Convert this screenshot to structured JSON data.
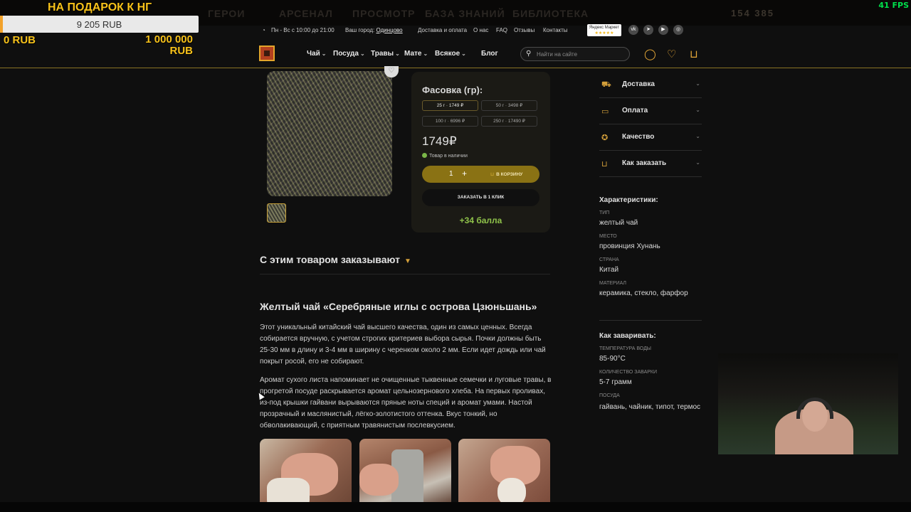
{
  "game": {
    "ghost_tabs": [
      "ГЕРОИ",
      "АРСЕНАЛ",
      "ПРОСМОТР",
      "БАЗА ЗНАНИЙ",
      "БИБЛИОТЕКА"
    ],
    "resources": "154 385",
    "fps": "41 FPS"
  },
  "donation": {
    "title": "НА ПОДАРОК К НГ",
    "amount": "9 205 RUB",
    "progress_fraction": 0.0092,
    "min": "0 RUB",
    "max_line1": "1 000 000",
    "max_line2": "RUB",
    "bar_fill_color": "#f2a22b",
    "text_color": "#f7c21a"
  },
  "topbar": {
    "hours": "Пн - Вс с 10:00 до 21:00",
    "city_label": "Ваш город:",
    "city": "Одинцово",
    "links": [
      "Доставка и оплата",
      "О нас",
      "FAQ",
      "Отзывы",
      "Контакты"
    ],
    "ya_market": "Яндекс Маркет",
    "ya_stars": "★★★★★",
    "social": [
      "vk-icon",
      "telegram-icon",
      "youtube-icon",
      "instagram-icon"
    ]
  },
  "nav": {
    "items": [
      "Чай",
      "Посуда",
      "Травы",
      "Мате",
      "Всякое"
    ],
    "blog": "Блог",
    "search_placeholder": "Найти на сайте",
    "accent": "#e6a838"
  },
  "product": {
    "pack_label": "Фасовка (гр):",
    "packs": [
      {
        "label": "25 г · 1749 ₽",
        "selected": true
      },
      {
        "label": "50 г · 3498 ₽",
        "selected": false
      },
      {
        "label": "100 г · 6996 ₽",
        "selected": false
      },
      {
        "label": "250 г · 17490 ₽",
        "selected": false
      }
    ],
    "price": "1749₽",
    "stock": "Товар в наличии",
    "qty": "1",
    "plus": "+",
    "to_cart": "В КОРЗИНУ",
    "one_click": "ЗАКАЗАТЬ В 1 КЛИК",
    "bonus": "+34 балла",
    "bonus_color": "#8fc24a",
    "button_color": "#8a7214"
  },
  "accordion": [
    {
      "icon": "truck-icon",
      "label": "Доставка"
    },
    {
      "icon": "wallet-icon",
      "label": "Оплата"
    },
    {
      "icon": "quality-badge-icon",
      "label": "Качество"
    },
    {
      "icon": "cart-order-icon",
      "label": "Как заказать"
    }
  ],
  "characteristics": {
    "title": "Характеристики:",
    "rows": [
      {
        "k": "тип",
        "v": "желтый чай"
      },
      {
        "k": "место",
        "v": "провинция Хунань"
      },
      {
        "k": "страна",
        "v": "Китай"
      },
      {
        "k": "материал",
        "v": "керамика, стекло, фарфор"
      }
    ]
  },
  "brewing": {
    "title": "Как заваривать:",
    "rows": [
      {
        "k": "температура воды",
        "v": "85-90°C"
      },
      {
        "k": "количество заварки",
        "v": "5-7 грамм"
      },
      {
        "k": "посуда",
        "v": "гайвань, чайник, типот, термос"
      }
    ]
  },
  "article": {
    "related": "С этим товаром заказывают",
    "title": "Желтый чай «Серебряные иглы с острова Цзюньшань»",
    "p1": "Этот уникальный китайский чай высшего качества, один из самых ценных. Всегда собирается вручную, с учетом строгих критериев выбора сырья. Почки должны быть 25-30 мм в длину и 3-4 мм в ширину с черенком около 2 мм. Если идет дождь или чай покрыт росой, его не собирают.",
    "p2": "Аромат сухого листа напоминает не очищенные тыквенные семечки и луговые травы, в прогретой посуде раскрывается аромат цельнозернового хлеба. На первых проливах, из-под крышки гайвани вырываются пряные ноты специй и аромат умами. Настой прозрачный и маслянистый, лёгко-золотистого оттенка. Вкус тонкий, но обволакивающий, с приятным травянистым послевкусием."
  }
}
